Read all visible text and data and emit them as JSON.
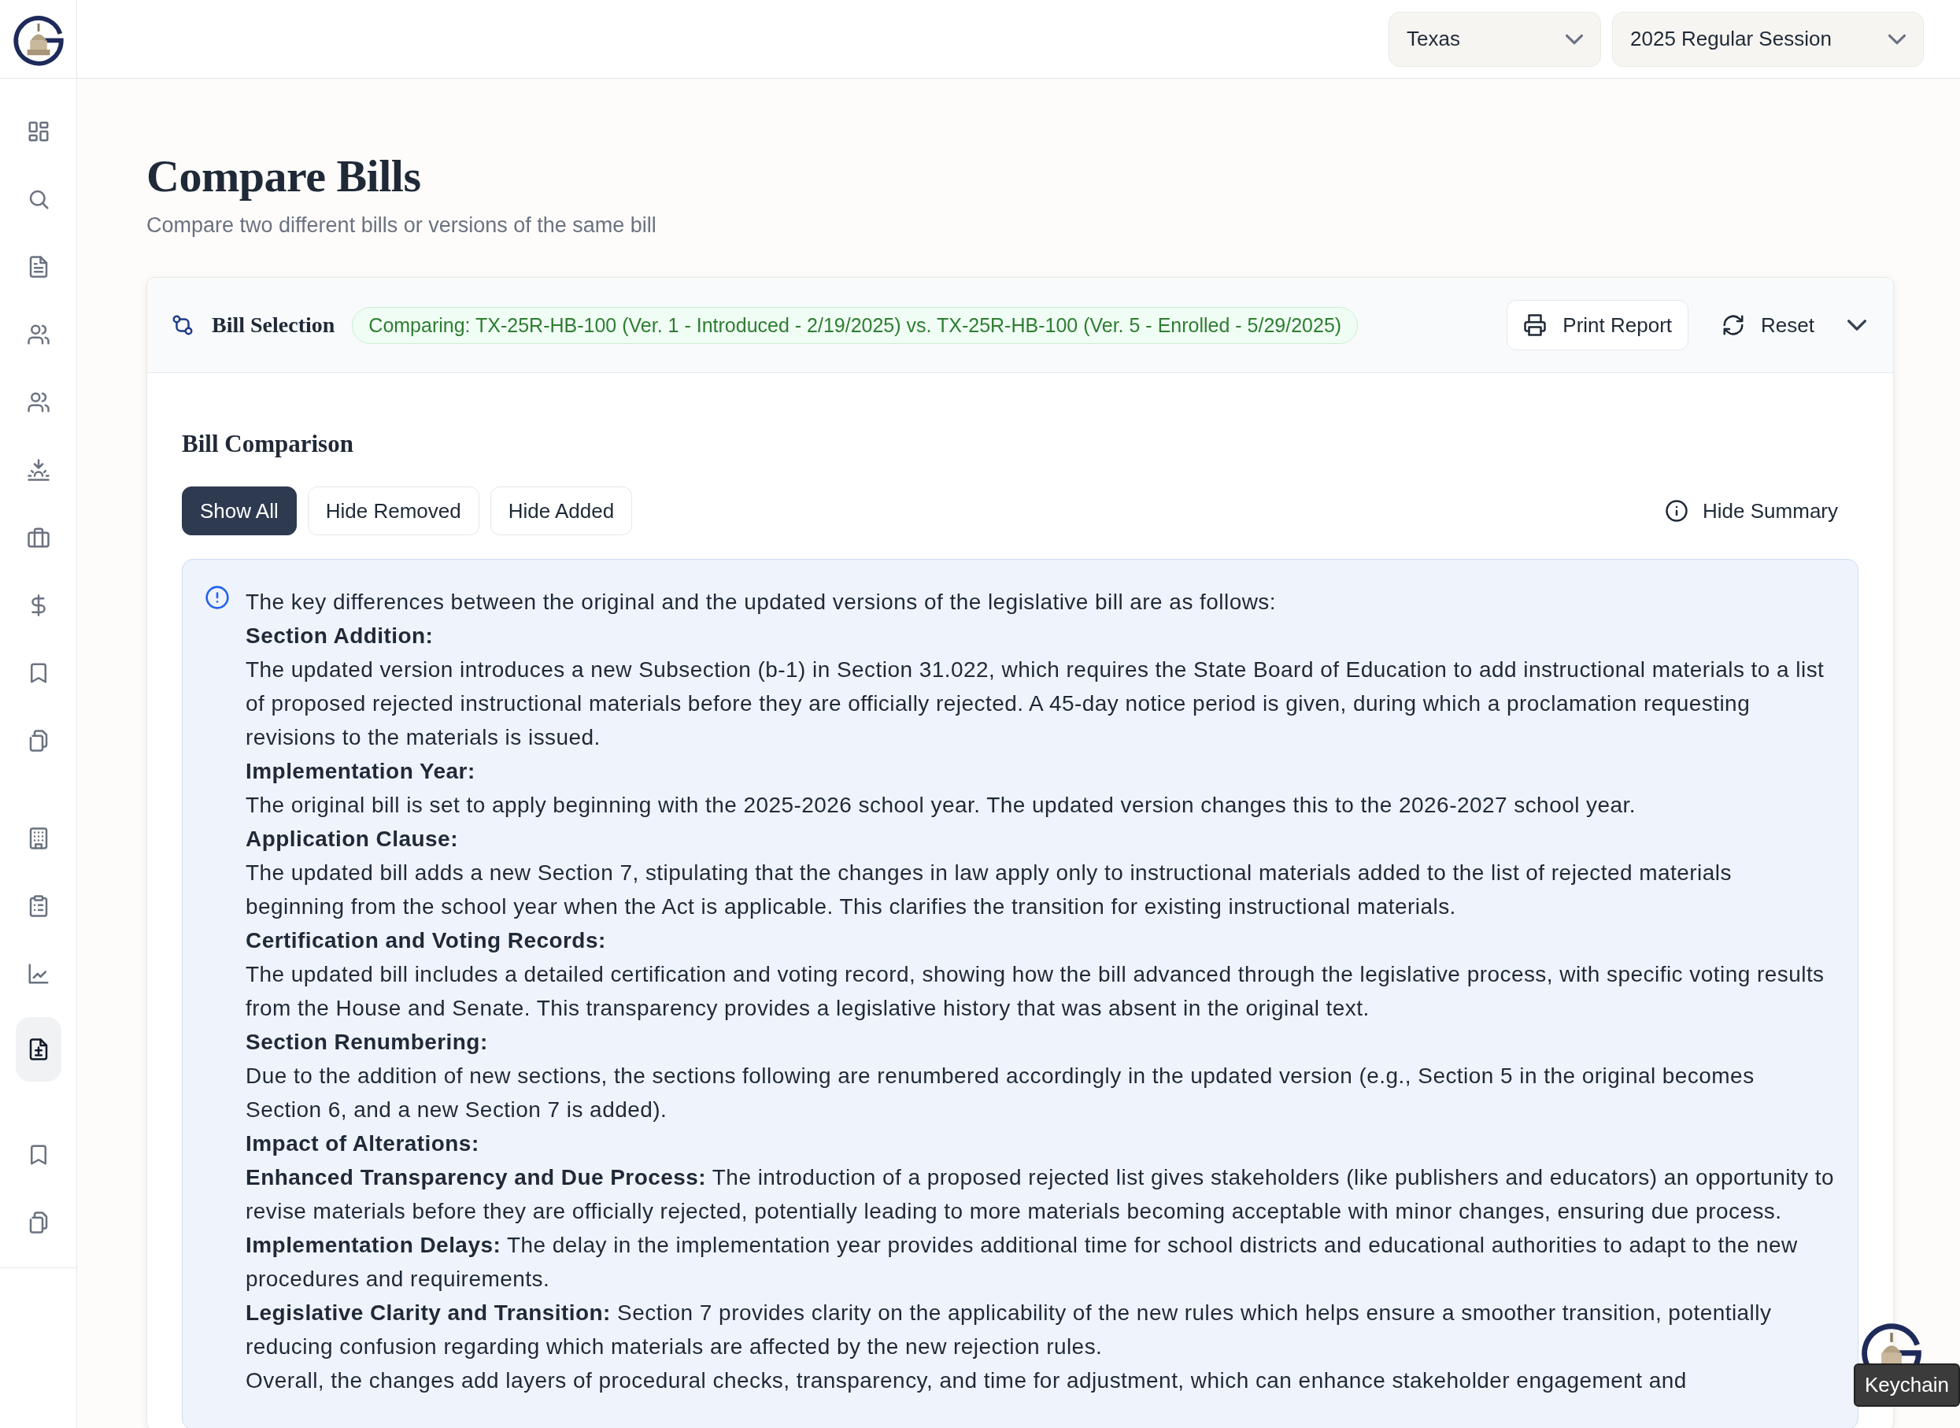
{
  "header": {
    "state_select": {
      "value": "Texas"
    },
    "session_select": {
      "value": "2025 Regular Session"
    }
  },
  "sidebar": {
    "groups": [
      {
        "items": [
          {
            "selected": false
          },
          {
            "selected": false
          },
          {
            "selected": false
          },
          {
            "selected": false
          },
          {
            "selected": false
          },
          {
            "selected": false
          },
          {
            "selected": false
          },
          {
            "selected": false
          },
          {
            "selected": false
          },
          {
            "selected": false
          }
        ]
      },
      {
        "items": [
          {
            "selected": false
          },
          {
            "selected": false
          },
          {
            "selected": false
          },
          {
            "selected": true
          }
        ]
      },
      {
        "items": [
          {
            "selected": false
          },
          {
            "selected": false
          }
        ]
      }
    ]
  },
  "page": {
    "title": "Compare Bills",
    "subtitle": "Compare two different bills or versions of the same bill"
  },
  "bill_selection": {
    "title": "Bill Selection",
    "comparing": "Comparing: TX-25R-HB-100 (Ver. 1 - Introduced - 2/19/2025) vs. TX-25R-HB-100 (Ver. 5 - Enrolled - 5/29/2025)",
    "buttons": [
      {
        "kind": "print",
        "label": "Print Report"
      },
      {
        "kind": "reset",
        "label": "Reset"
      }
    ]
  },
  "comparison": {
    "title": "Bill Comparison",
    "filters": [
      {
        "label": "Show All",
        "selected": true
      },
      {
        "label": "Hide Removed",
        "selected": false
      },
      {
        "label": "Hide Added",
        "selected": false
      }
    ],
    "summary_toggle": "Hide Summary",
    "summary": [
      {
        "kind": "text",
        "text": "The key differences between the original and the updated versions of the legislative bill are as follows:"
      },
      {
        "kind": "heading",
        "text": "Section Addition:"
      },
      {
        "kind": "text",
        "text": "The updated version introduces a new Subsection (b-1) in Section 31.022, which requires the State Board of Education to add instructional materials to a list of proposed rejected instructional materials before they are officially rejected. A 45-day notice period is given, during which a proclamation requesting revisions to the materials is issued."
      },
      {
        "kind": "heading",
        "text": "Implementation Year:"
      },
      {
        "kind": "text",
        "text": "The original bill is set to apply beginning with the 2025-2026 school year. The updated version changes this to the 2026-2027 school year."
      },
      {
        "kind": "heading",
        "text": "Application Clause:"
      },
      {
        "kind": "text",
        "text": "The updated bill adds a new Section 7, stipulating that the changes in law apply only to instructional materials added to the list of rejected materials beginning from the school year when the Act is applicable. This clarifies the transition for existing instructional materials."
      },
      {
        "kind": "heading",
        "text": "Certification and Voting Records:"
      },
      {
        "kind": "text",
        "text": "The updated bill includes a detailed certification and voting record, showing how the bill advanced through the legislative process, with specific voting results from the House and Senate. This transparency provides a legislative history that was absent in the original text."
      },
      {
        "kind": "heading",
        "text": "Section Renumbering:"
      },
      {
        "kind": "text",
        "text": "Due to the addition of new sections, the sections following are renumbered accordingly in the updated version (e.g., Section 5 in the original becomes Section 6, and a new Section 7 is added)."
      },
      {
        "kind": "heading",
        "text": "Impact of Alterations:"
      },
      {
        "kind": "text",
        "text": "**Enhanced Transparency and Due Process:** The introduction of a proposed rejected list gives stakeholders (like publishers and educators) an opportunity to revise materials before they are officially rejected, potentially leading to more materials becoming acceptable with minor changes, ensuring due process."
      },
      {
        "kind": "text",
        "text": "**Implementation Delays:** The delay in the implementation year provides additional time for school districts and educational authorities to adapt to the new procedures and requirements."
      },
      {
        "kind": "text",
        "text": "**Legislative Clarity and Transition:** Section 7 provides clarity on the applicability of the new rules which helps ensure a smoother transition, potentially reducing confusion regarding which materials are affected by the new rejection rules."
      },
      {
        "kind": "text",
        "text": "Overall, the changes add layers of procedural checks, transparency, and time for adjustment, which can enhance stakeholder engagement and"
      }
    ]
  },
  "assistant": {
    "tooltip": "Keychain"
  }
}
